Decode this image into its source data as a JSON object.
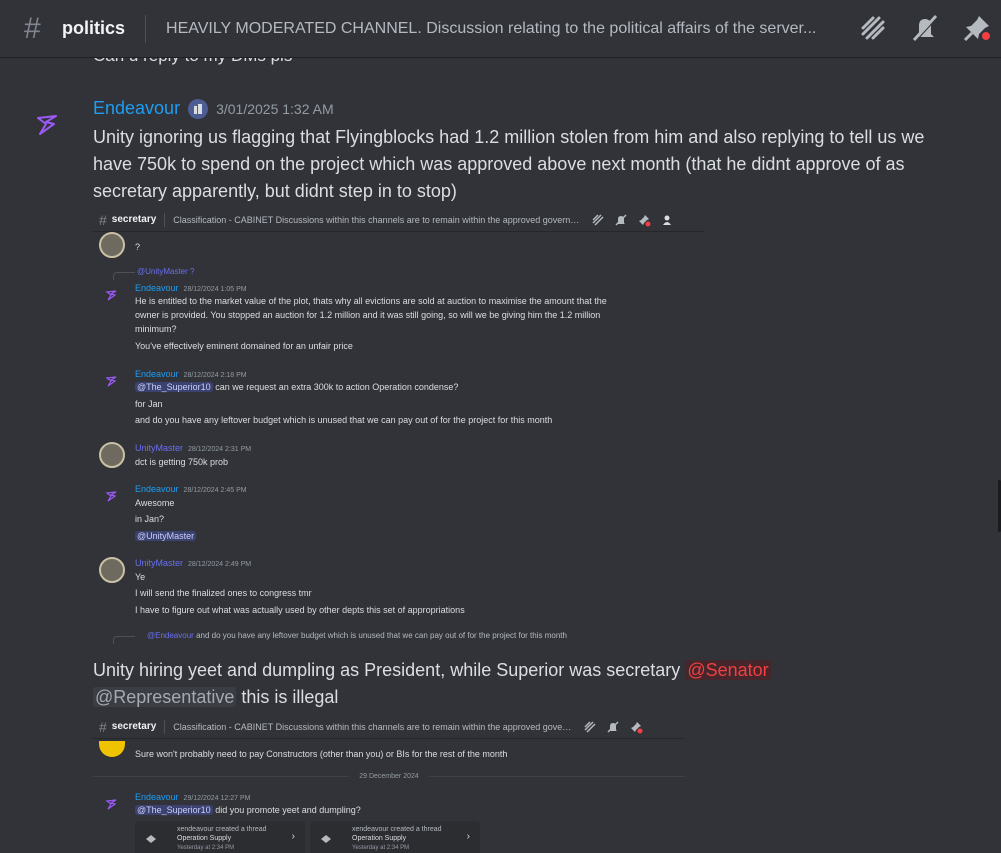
{
  "header": {
    "channel_name": "politics",
    "topic": "HEAVILY MODERATED CHANNEL. Discussion relating to the political affairs of the server...",
    "icons": [
      "threads-icon",
      "mute-icon",
      "pin-icon"
    ]
  },
  "cut_text": "Can u reply to my DMs pls",
  "message": {
    "author": "Endeavour",
    "timestamp": "3/01/2025 1:32 AM",
    "text": "Unity ignoring us flagging that Flyingblocks had 1.2 million stolen from him and also replying to tell us we have 750k to spend on the project which was approved above next month (that he didnt approve of as secretary apparently, but didnt step in to stop)",
    "text2": "Unity hiring yeet and dumpling as President, while Superior was secretary",
    "mention_senator": "@Senator",
    "mention_rep": "@Representative",
    "text2_end": "this is illegal"
  },
  "shot1": {
    "channel": "secretary",
    "topic": "Classification - CABINET Discussions within this channels are to remain within the approved government cha...",
    "q": "?",
    "reply_to": "@UnityMaster ?",
    "m1_author": "Endeavour",
    "m1_time": "28/12/2024 1:05 PM",
    "m1_l1": "He is entitled to the market value of the plot, thats why all evictions are sold at auction to maximise the amount that the",
    "m1_l2": "owner is provided. You stopped an auction for 1.2 million and it was still going, so will we be giving him the 1.2 million",
    "m1_l3": "minimum?",
    "m1_l4": "You've effectively eminent domained for an unfair price",
    "m2_author": "Endeavour",
    "m2_time": "28/12/2024 2:18 PM",
    "m2_mention": "@The_Superior10",
    "m2_l1": "can we request an extra 300k to action Operation condense?",
    "m2_l2": "for Jan",
    "m2_l3": "and do you have any leftover budget which is unused that we can pay out of for the project for this month",
    "m3_author": "UnityMaster",
    "m3_time": "28/12/2024 2:31 PM",
    "m3_l1": "dct is getting 750k prob",
    "m4_author": "Endeavour",
    "m4_time": "28/12/2024 2:45 PM",
    "m4_l1": "Awesome",
    "m4_l2": "in Jan?",
    "m4_mention": "@UnityMaster",
    "m5_author": "UnityMaster",
    "m5_time": "28/12/2024 2:49 PM",
    "m5_l1": "Ye",
    "m5_l2": "I will send the finalized ones to congress tmr",
    "m5_l3": "I have to figure out what was actually used by other depts this set of appropriations",
    "bottom_reply_mention": "@Endeavour",
    "bottom_reply": "and do you have any leftover budget which is unused that we can pay out of for the project for this month"
  },
  "shot2": {
    "channel": "secretary",
    "topic": "Classification - CABINET Discussions within this channels are to remain within the approved government cha...",
    "l0": "Sure won't probably need to pay Constructors (other than you) or BIs for the rest of the month",
    "date": "29 December 2024",
    "author": "Endeavour",
    "time": "29/12/2024 12:27 PM",
    "mention": "@The_Superior10",
    "text": "did you promote yeet and dumpling?",
    "card1_title": "xendeavour created a thread",
    "card1_sub": "Operation Supply",
    "card1_time": "Yesterday at 2:34 PM",
    "card2_title": "xendeavour created a thread",
    "card2_sub": "Operation Supply",
    "card2_time": "Yesterday at 2:34 PM"
  },
  "colors": {
    "background": "#313338",
    "link": "#1e9df2",
    "mention_red": "#f23f42"
  }
}
